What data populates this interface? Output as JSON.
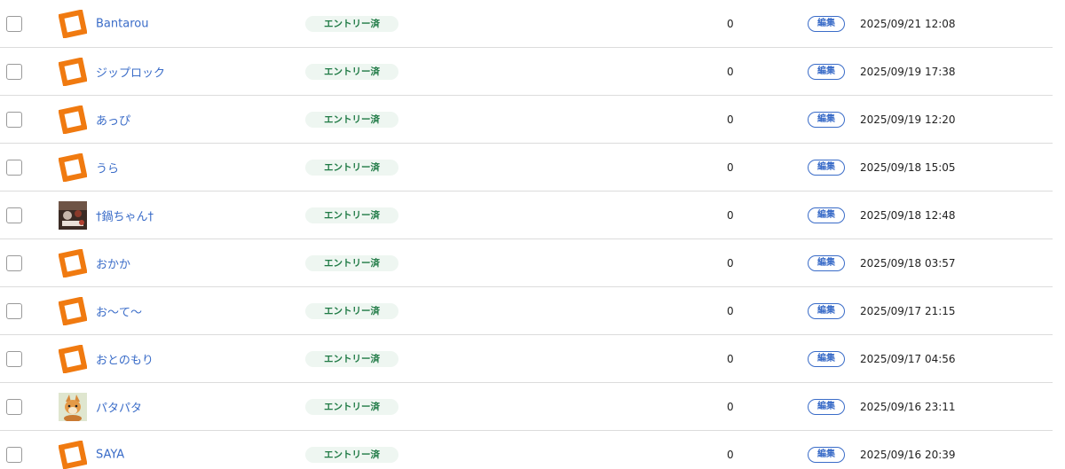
{
  "colors": {
    "link": "#3a6cc8",
    "status_bg": "#eef6f1",
    "status_text": "#1f7a45",
    "avatar_orange": "#f07a10",
    "divider": "#dcdcdc"
  },
  "rows": [
    {
      "name": "Bantarou",
      "avatar": "default-orange-avatar-icon",
      "status": "エントリー済",
      "count": "0",
      "edit": "編集",
      "date": "2025/09/21 12:08"
    },
    {
      "name": "ジップロック",
      "avatar": "default-orange-avatar-icon",
      "status": "エントリー済",
      "count": "0",
      "edit": "編集",
      "date": "2025/09/19 17:38"
    },
    {
      "name": "あっぴ",
      "avatar": "default-orange-avatar-icon",
      "status": "エントリー済",
      "count": "0",
      "edit": "編集",
      "date": "2025/09/19 12:20"
    },
    {
      "name": "うら",
      "avatar": "default-orange-avatar-icon",
      "status": "エントリー済",
      "count": "0",
      "edit": "編集",
      "date": "2025/09/18 15:05"
    },
    {
      "name": "†鍋ちゃん†",
      "avatar": "photo-avatar-dark",
      "status": "エントリー済",
      "count": "0",
      "edit": "編集",
      "date": "2025/09/18 12:48"
    },
    {
      "name": "おかか",
      "avatar": "default-orange-avatar-icon",
      "status": "エントリー済",
      "count": "0",
      "edit": "編集",
      "date": "2025/09/18 03:57"
    },
    {
      "name": "お〜て〜",
      "avatar": "default-orange-avatar-icon",
      "status": "エントリー済",
      "count": "0",
      "edit": "編集",
      "date": "2025/09/17 21:15"
    },
    {
      "name": "おとのもり",
      "avatar": "default-orange-avatar-icon",
      "status": "エントリー済",
      "count": "0",
      "edit": "編集",
      "date": "2025/09/17 04:56"
    },
    {
      "name": "パタパタ",
      "avatar": "illustration-avatar-fox",
      "status": "エントリー済",
      "count": "0",
      "edit": "編集",
      "date": "2025/09/16 23:11"
    },
    {
      "name": "SAYA",
      "avatar": "default-orange-avatar-icon",
      "status": "エントリー済",
      "count": "0",
      "edit": "編集",
      "date": "2025/09/16 20:39"
    }
  ]
}
